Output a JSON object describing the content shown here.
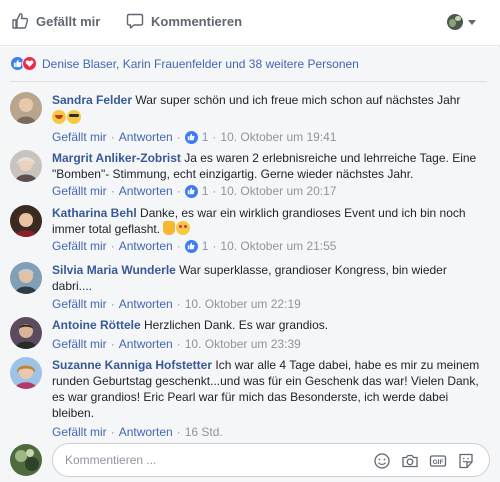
{
  "action_bar": {
    "like_label": "Gefällt mir",
    "comment_label": "Kommentieren"
  },
  "reactions": {
    "summary": "Denise Blaser, Karin Frauenfelder und 38 weitere Personen"
  },
  "comments": [
    {
      "author": "Sandra Felder",
      "text": "War super schön und ich freue mich schon auf nächstes Jahr",
      "like_label": "Gefällt mir",
      "reply_label": "Antworten",
      "likes": "1",
      "time": "10. Oktober um 19:41"
    },
    {
      "author": "Margrit Anliker-Zobrist",
      "text": "Ja es waren 2 erlebnisreiche und lehrreiche Tage. Eine \"Bomben\"- Stimmung, echt einzigartig. Gerne wieder nächstes Jahr.",
      "like_label": "Gefällt mir",
      "reply_label": "Antworten",
      "likes": "1",
      "time": "10. Oktober um 20:17"
    },
    {
      "author": "Katharina Behl",
      "text": "Danke, es war ein wirklich grandioses Event und ich bin noch immer total geflasht.",
      "like_label": "Gefällt mir",
      "reply_label": "Antworten",
      "likes": "1",
      "time": "10. Oktober um 21:55"
    },
    {
      "author": "Silvia Maria Wunderle",
      "text": "War superklasse, grandioser Kongress, bin wieder dabri....",
      "like_label": "Gefällt mir",
      "reply_label": "Antworten",
      "time": "10. Oktober um 22:19"
    },
    {
      "author": "Antoine Röttele",
      "text": "Herzlichen Dank. Es war grandios.",
      "like_label": "Gefällt mir",
      "reply_label": "Antworten",
      "time": "10. Oktober um 23:39"
    },
    {
      "author": "Suzanne Kanniga Hofstetter",
      "text": "Ich war alle 4 Tage dabei, habe es mir zu meinem runden Geburtstag geschenkt...und was für ein Geschenk das war! Vielen Dank, es war grandios! Eric Pearl war für mich das Besonderste, ich werde dabei bleiben.",
      "like_label": "Gefällt mir",
      "reply_label": "Antworten",
      "time": "16 Std."
    }
  ],
  "compose": {
    "placeholder": "Kommentieren ..."
  },
  "colors": {
    "link": "#385898",
    "like_blue": "#3b7cf5",
    "love_red": "#f0284a",
    "meta_gray": "#90949c"
  }
}
